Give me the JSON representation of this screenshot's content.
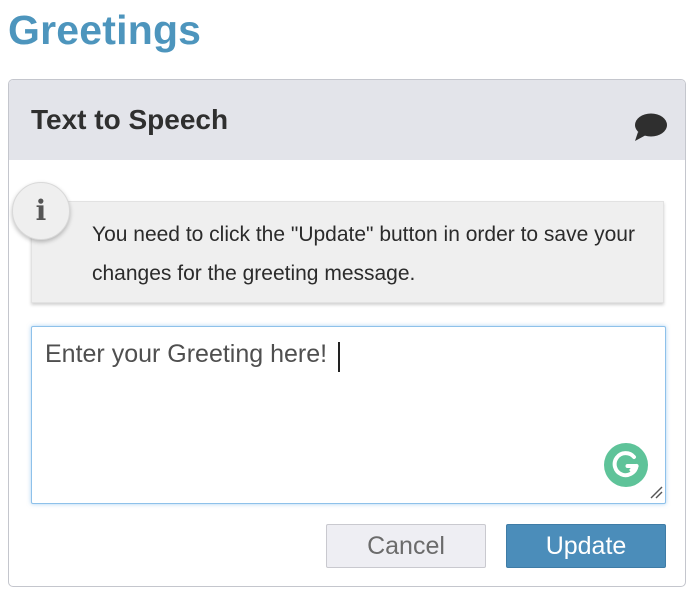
{
  "page": {
    "title": "Greetings"
  },
  "panel": {
    "title": "Text to Speech",
    "header_icon": "speech-bubble-icon"
  },
  "info": {
    "badge": "i",
    "badge_icon": "info-icon",
    "message": "You need to click the \"Update\" button in order to save your changes for the greeting message."
  },
  "greeting": {
    "value": "Enter your Greeting here!",
    "assist_icon": "grammarly-icon"
  },
  "actions": {
    "cancel_label": "Cancel",
    "update_label": "Update"
  },
  "colors": {
    "title_accent": "#4d95bd",
    "header_background": "#e3e4ea",
    "update_button": "#4b8dba",
    "grammarly": "#5ec399"
  }
}
